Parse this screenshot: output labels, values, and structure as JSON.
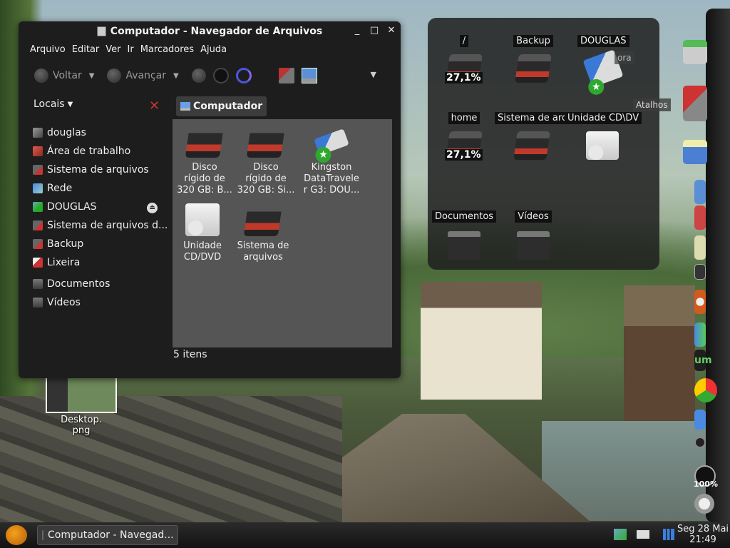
{
  "file_manager": {
    "title": "Computador - Navegador de Arquivos",
    "window_controls": {
      "minimize": "_",
      "maximize": "□",
      "close": "✕"
    },
    "menu": [
      "Arquivo",
      "Editar",
      "Ver",
      "Ir",
      "Marcadores",
      "Ajuda"
    ],
    "toolbar": {
      "back": "Voltar",
      "forward": "Avançar"
    },
    "sidebar": {
      "header": "Locais",
      "items": [
        {
          "label": "douglas",
          "icon": "home-folder-icon"
        },
        {
          "label": "Área de trabalho",
          "icon": "desktop-icon"
        },
        {
          "label": "Sistema de arquivos",
          "icon": "hard-disk-icon"
        },
        {
          "label": "Rede",
          "icon": "network-icon"
        },
        {
          "label": "DOUGLAS",
          "icon": "usb-drive-icon"
        },
        {
          "label": "Sistema de arquivos d...",
          "icon": "hard-disk-icon"
        },
        {
          "label": "Backup",
          "icon": "hard-disk-icon"
        },
        {
          "label": "Lixeira",
          "icon": "trash-icon"
        },
        {
          "label": "Documentos",
          "icon": "folder-icon"
        },
        {
          "label": "Vídeos",
          "icon": "folder-icon"
        }
      ]
    },
    "location": "Computador",
    "files": [
      {
        "name_lines": [
          "Disco",
          "rígido de",
          "320 GB: B..."
        ],
        "icon": "hard-disk-icon"
      },
      {
        "name_lines": [
          "Disco",
          "rígido de",
          "320 GB: Si..."
        ],
        "icon": "hard-disk-icon"
      },
      {
        "name_lines": [
          "Kingston",
          "DataTravele",
          "r G3: DOU..."
        ],
        "icon": "usb-drive-icon"
      },
      {
        "name_lines": [
          "Unidade",
          "CD/DVD"
        ],
        "icon": "cd-drive-icon"
      },
      {
        "name_lines": [
          "Sistema de",
          "arquivos"
        ],
        "icon": "hard-disk-icon"
      }
    ],
    "status": "5 itens"
  },
  "devices_widget": {
    "items": [
      {
        "label": "/",
        "usage": "27,1%"
      },
      {
        "label": "Backup"
      },
      {
        "label": "DOUGLAS"
      },
      {
        "label": "home",
        "usage": "27,1%"
      },
      {
        "label": "Sistema de arq"
      },
      {
        "label": "Unidade CD\\DV"
      },
      {
        "label": "Documentos"
      },
      {
        "label": "Vídeos"
      }
    ]
  },
  "dock": {
    "side_labels": [
      "ora",
      "Atalhos"
    ],
    "battery": "100%"
  },
  "desktop": {
    "file_lines": [
      "Desktop.",
      "png"
    ]
  },
  "taskbar": {
    "task": "Computador - Navegad...",
    "clock_date": "Seg 28 Mai",
    "clock_time": "21:49"
  }
}
